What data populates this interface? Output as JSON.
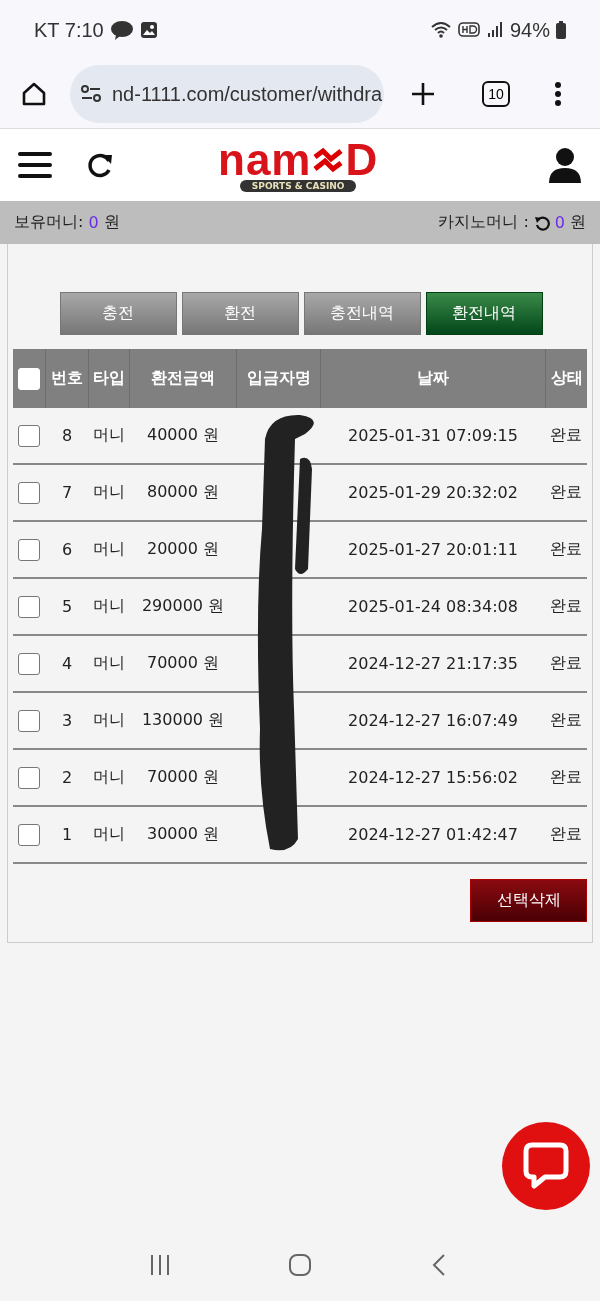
{
  "status_bar": {
    "carrier": "KT",
    "time": "7:10",
    "battery": "94%"
  },
  "browser": {
    "url": "nd-1111.com/customer/withdra",
    "tab_count": "10"
  },
  "logo": {
    "text": "nam",
    "text_end": "D",
    "tagline": "SPORTS & CASINO"
  },
  "balance": {
    "label": "보유머니:",
    "amount": "0",
    "unit": "원",
    "casino_label": "카지노머니 :",
    "casino_amount": "0",
    "casino_unit": "원"
  },
  "tabs": [
    {
      "label": "충전",
      "selected": false
    },
    {
      "label": "환전",
      "selected": false
    },
    {
      "label": "충전내역",
      "selected": false
    },
    {
      "label": "환전내역",
      "selected": true
    }
  ],
  "table": {
    "columns": [
      "번호",
      "타입",
      "환전금액",
      "입금자명",
      "날짜",
      "상태"
    ],
    "select_all_checked": false,
    "rows": [
      {
        "no": "8",
        "type": "머니",
        "amount": "40000 원",
        "date": "2025-01-31 07:09:15",
        "status": "완료",
        "checked": false
      },
      {
        "no": "7",
        "type": "머니",
        "amount": "80000 원",
        "date": "2025-01-29 20:32:02",
        "status": "완료",
        "checked": false
      },
      {
        "no": "6",
        "type": "머니",
        "amount": "20000 원",
        "date": "2025-01-27 20:01:11",
        "status": "완료",
        "checked": false
      },
      {
        "no": "5",
        "type": "머니",
        "amount": "290000 원",
        "date": "2025-01-24 08:34:08",
        "status": "완료",
        "checked": false
      },
      {
        "no": "4",
        "type": "머니",
        "amount": "70000 원",
        "date": "2024-12-27 21:17:35",
        "status": "완료",
        "checked": false
      },
      {
        "no": "3",
        "type": "머니",
        "amount": "130000 원",
        "date": "2024-12-27 16:07:49",
        "status": "완료",
        "checked": false
      },
      {
        "no": "2",
        "type": "머니",
        "amount": "70000 원",
        "date": "2024-12-27 15:56:02",
        "status": "완료",
        "checked": false
      },
      {
        "no": "1",
        "type": "머니",
        "amount": "30000 원",
        "date": "2024-12-27 01:42:47",
        "status": "완료",
        "checked": false
      }
    ]
  },
  "delete_button": "선택삭제"
}
